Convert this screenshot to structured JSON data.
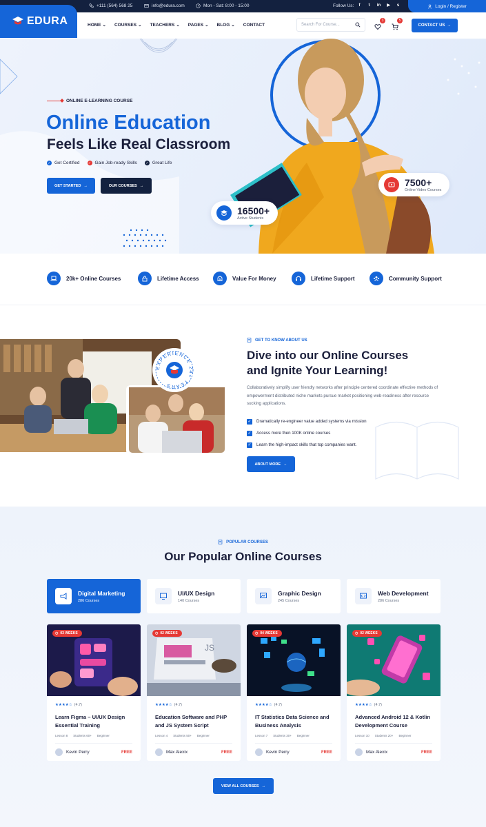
{
  "topbar": {
    "phone": "+111 (564) 568 25",
    "email": "info@edura.com",
    "hours": "Mon - Sat: 8:00 - 15:00",
    "follow_label": "Follow Us:",
    "login_label": "Login / Register"
  },
  "header": {
    "logo_text": "EDURA",
    "nav": [
      "HOME",
      "COURSES",
      "TEACHERS",
      "PAGES",
      "BLOG",
      "CONTACT"
    ],
    "search_placeholder": "Search For Course...",
    "wishlist_count": "3",
    "cart_count": "5",
    "contact_label": "CONTACT US"
  },
  "hero": {
    "tag": "ONLINE E-LEARNING COURSE",
    "title_line1": "Online Education",
    "title_line2": "Feels Like Real Classroom",
    "checks": [
      {
        "label": "Get Certified",
        "color": "#1565d8"
      },
      {
        "label": "Gain Job-ready Skills",
        "color": "#e53935"
      },
      {
        "label": "Great Life",
        "color": "#13213f"
      }
    ],
    "btn_primary": "GET STARTED",
    "btn_secondary": "OUR COURSES",
    "stat_students_num": "16500+",
    "stat_students_lbl": "Active Students",
    "stat_videos_num": "7500+",
    "stat_videos_lbl": "Online Video Courses"
  },
  "features": [
    {
      "label": "20k+ Online Courses",
      "icon": "laptop-icon"
    },
    {
      "label": "Lifetime Access",
      "icon": "lock-icon"
    },
    {
      "label": "Value For Money",
      "icon": "money-icon"
    },
    {
      "label": "Lifetime Support",
      "icon": "headset-icon"
    },
    {
      "label": "Community Support",
      "icon": "community-icon"
    }
  ],
  "about": {
    "badge_text": "EXPERIENCE 24+ YEARS",
    "tag": "GET TO KNOW ABOUT US",
    "title_line1": "Dive into our Online Courses",
    "title_line2": "and Ignite Your Learning!",
    "paragraph": "Collaboratively simplify user friendly networks after principle centered coordinate effective methods of empowerment distributed niche markets pursue market positioning web-readiness after resource sucking applications.",
    "list": [
      "Dramatically re-engineer value added systems via mission",
      "Access more then 100K online courses",
      "Learn the high-impact skills that top companies want."
    ],
    "btn": "ABOUT MORE"
  },
  "courses": {
    "tag": "POPULAR COURSES",
    "title": "Our Popular Online Courses",
    "categories": [
      {
        "title": "Digital Marketing",
        "sub": "286 Courses"
      },
      {
        "title": "UI/UX Design",
        "sub": "140 Courses"
      },
      {
        "title": "Graphic Design",
        "sub": "245 Courses"
      },
      {
        "title": "Web Development",
        "sub": "286 Courses"
      }
    ],
    "cards": [
      {
        "weeks": "03 WEEKS",
        "rating": "(4.7)",
        "stars": 4,
        "title": "Learn Figma – UI/UX Design Essential Training",
        "lesson": "Lesson 8",
        "students": "Students 60+",
        "level": "Beginner",
        "author": "Kevin Perry",
        "price": "FREE"
      },
      {
        "weeks": "02 WEEKS",
        "rating": "(4.7)",
        "stars": 4,
        "title": "Education Software and PHP and JS System Script",
        "lesson": "Lesson 4",
        "students": "Students 50+",
        "level": "Beginner",
        "author": "Max Alexix",
        "price": "FREE"
      },
      {
        "weeks": "04 WEEKS",
        "rating": "(4.7)",
        "stars": 4,
        "title": "IT Statistics Data Science and Business Analysis",
        "lesson": "Lesson 7",
        "students": "Students 30+",
        "level": "Beginner",
        "author": "Kevin Perry",
        "price": "FREE"
      },
      {
        "weeks": "02 WEEKS",
        "rating": "(4.7)",
        "stars": 4,
        "title": "Advanced Android 12 & Kotlin Development Course",
        "lesson": "Lesson 10",
        "students": "Students 20+",
        "level": "Beginner",
        "author": "Max Alexix",
        "price": "FREE"
      }
    ],
    "view_all": "VIEW ALL COURSES"
  },
  "colors": {
    "primary": "#1565d8",
    "dark": "#13213f",
    "accent_red": "#e53935"
  }
}
